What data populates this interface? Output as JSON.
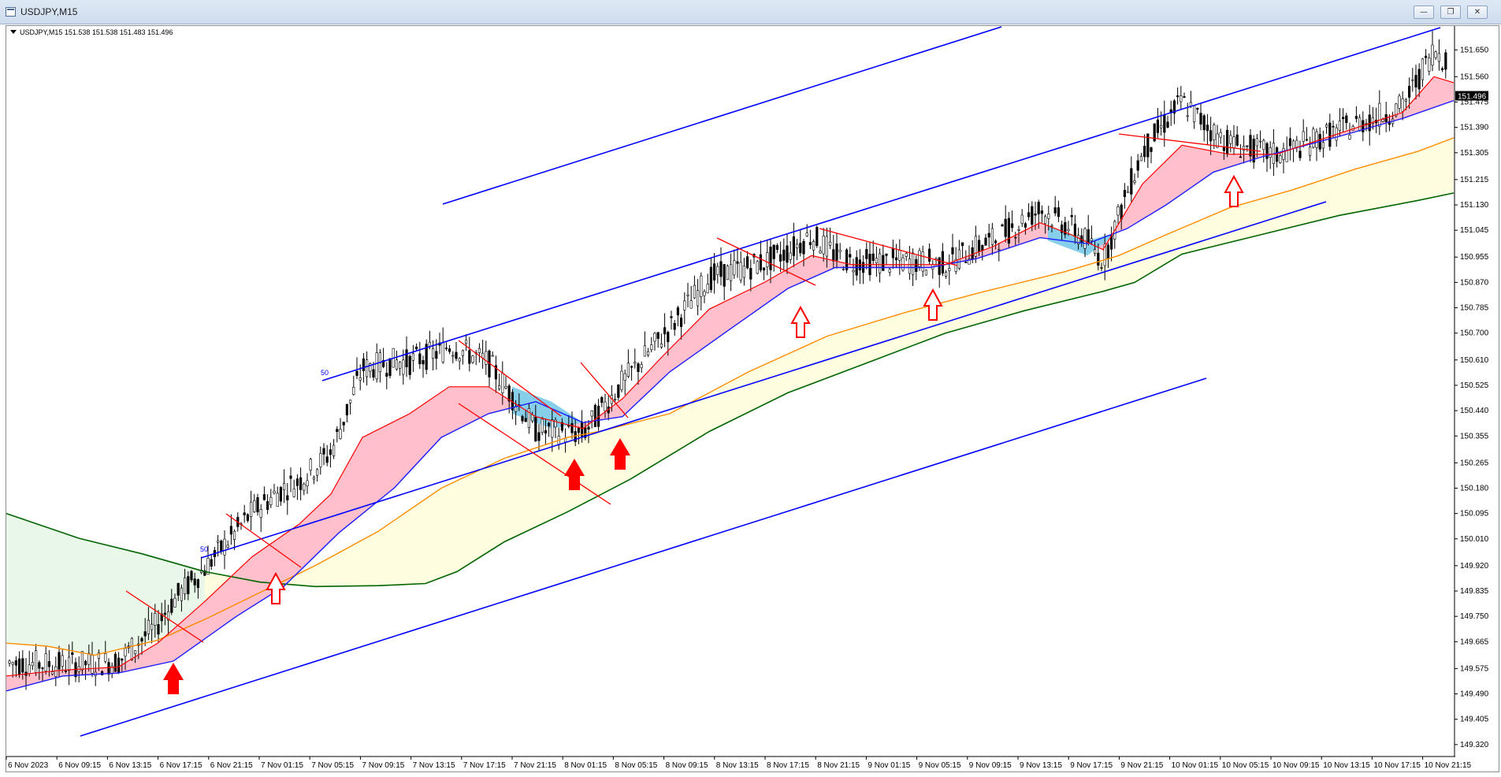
{
  "window": {
    "title": "USDJPY,M15",
    "minimize_icon": "minimize-icon",
    "restore_icon": "restore-icon",
    "close_icon": "close-icon"
  },
  "chart_info": "USDJPY,M15  151.538 151.538 151.483 151.496",
  "chart_data": {
    "type": "candlestick",
    "symbol": "USDJPY",
    "timeframe": "M15",
    "ohlc": {
      "open": 151.538,
      "high": 151.538,
      "low": 151.483,
      "close": 151.496
    },
    "current_price_label": "151.496",
    "ylim": [
      149.28,
      151.73
    ],
    "y_ticks": [
      "151.650",
      "151.560",
      "151.475",
      "151.390",
      "151.305",
      "151.215",
      "151.130",
      "151.045",
      "150.955",
      "150.870",
      "150.785",
      "150.700",
      "150.610",
      "150.525",
      "150.440",
      "150.355",
      "150.265",
      "150.180",
      "150.095",
      "150.010",
      "149.920",
      "149.835",
      "149.750",
      "149.665",
      "149.575",
      "149.490",
      "149.405",
      "149.320"
    ],
    "x_ticks": [
      "6 Nov 2023",
      "6 Nov 09:15",
      "6 Nov 13:15",
      "6 Nov 17:15",
      "6 Nov 21:15",
      "7 Nov 01:15",
      "7 Nov 05:15",
      "7 Nov 09:15",
      "7 Nov 13:15",
      "7 Nov 17:15",
      "7 Nov 21:15",
      "8 Nov 01:15",
      "8 Nov 05:15",
      "8 Nov 09:15",
      "8 Nov 13:15",
      "8 Nov 17:15",
      "8 Nov 21:15",
      "9 Nov 01:15",
      "9 Nov 05:15",
      "9 Nov 09:15",
      "9 Nov 13:15",
      "9 Nov 17:15",
      "9 Nov 21:15",
      "10 Nov 01:15",
      "10 Nov 05:15",
      "10 Nov 09:15",
      "10 Nov 13:15",
      "10 Nov 17:15",
      "10 Nov 21:15"
    ],
    "channel_labels": [
      "50",
      "50"
    ],
    "colors": {
      "channel": "#0000ff",
      "trend_lines": "#ff0000",
      "ma_fast_cloud": "#ffc0cb",
      "ma_fast": "#ff0000",
      "ma_medium": "#1c1cff",
      "ma_slow": "#ff8c00",
      "ma_long": "#006400",
      "long_cloud": "#fffde0",
      "green_cloud": "#e8f7e8",
      "bear_cloud": "#87ceeb",
      "arrows": "#ff0000",
      "candles": "#000000"
    }
  }
}
